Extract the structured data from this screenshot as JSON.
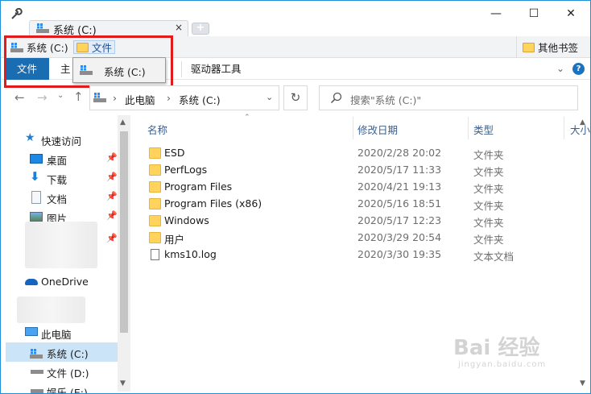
{
  "tab": {
    "title": "系统 (C:)",
    "close": "×",
    "new_tab": "+"
  },
  "window_buttons": {
    "minimize": "—",
    "maximize": "☐",
    "close": "✕"
  },
  "bookmarks": {
    "drive": "系统 (C:)",
    "folder": "文件",
    "other": "其他书签"
  },
  "ribbon": {
    "file": "文件",
    "main": "主",
    "drive_tools": "驱动器工具"
  },
  "dropdown": {
    "item": "系统 (C:)"
  },
  "address": {
    "crumbs": [
      "此电脑",
      "系统 (C:)"
    ],
    "sep": "›"
  },
  "search": {
    "placeholder": "搜索\"系统 (C:)\""
  },
  "sidebar": {
    "quick_access": "快速访问",
    "items": [
      {
        "label": "桌面"
      },
      {
        "label": "下载"
      },
      {
        "label": "文档"
      },
      {
        "label": "图片"
      }
    ],
    "onedrive": "OneDrive",
    "this_pc": "此电脑",
    "drives": [
      {
        "label": "系统 (C:)"
      },
      {
        "label": "文件 (D:)"
      },
      {
        "label": "娱乐 (E:)"
      }
    ]
  },
  "columns": {
    "name": "名称",
    "date": "修改日期",
    "type": "类型",
    "size": "大小"
  },
  "files": [
    {
      "name": "ESD",
      "date": "2020/2/28 20:02",
      "type": "文件夹",
      "icon": "folder"
    },
    {
      "name": "PerfLogs",
      "date": "2020/5/17 11:33",
      "type": "文件夹",
      "icon": "folder"
    },
    {
      "name": "Program Files",
      "date": "2020/4/21 19:13",
      "type": "文件夹",
      "icon": "folder"
    },
    {
      "name": "Program Files (x86)",
      "date": "2020/5/16 18:51",
      "type": "文件夹",
      "icon": "folder"
    },
    {
      "name": "Windows",
      "date": "2020/5/17 12:23",
      "type": "文件夹",
      "icon": "folder"
    },
    {
      "name": "用户",
      "date": "2020/3/29 20:54",
      "type": "文件夹",
      "icon": "folder"
    },
    {
      "name": "kms10.log",
      "date": "2020/3/30 19:35",
      "type": "文本文档",
      "icon": "text-file"
    }
  ],
  "watermark": {
    "main": "Bai 经验",
    "sub": "jingyan.baidu.com"
  },
  "colors": {
    "accent": "#1b6db2",
    "highlight": "#e31a1c",
    "selection": "#cce4f7",
    "folder": "#ffd35c"
  }
}
